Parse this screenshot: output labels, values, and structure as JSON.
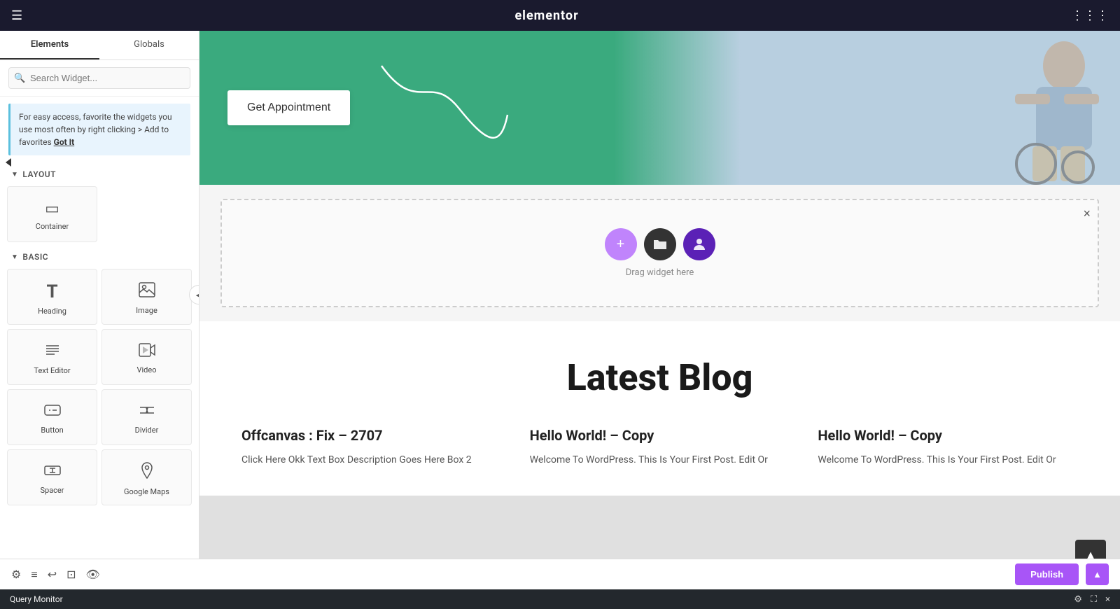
{
  "topbar": {
    "logo": "elementor",
    "hamburger_label": "☰",
    "grid_label": "⋮⋮⋮"
  },
  "sidebar": {
    "tabs": [
      {
        "id": "elements",
        "label": "Elements",
        "active": true
      },
      {
        "id": "globals",
        "label": "Globals",
        "active": false
      }
    ],
    "search_placeholder": "Search Widget...",
    "hint_text": "For easy access, favorite the widgets you use most often by right clicking > Add to favorites",
    "hint_cta": "Got It",
    "layout_section": {
      "label": "Layout",
      "widgets": [
        {
          "id": "container",
          "label": "Container",
          "icon": "▭"
        }
      ]
    },
    "basic_section": {
      "label": "Basic",
      "widgets": [
        {
          "id": "heading",
          "label": "Heading",
          "icon": "T"
        },
        {
          "id": "image",
          "label": "Image",
          "icon": "🖼"
        },
        {
          "id": "text-editor",
          "label": "Text Editor",
          "icon": "≡"
        },
        {
          "id": "video",
          "label": "Video",
          "icon": "▶"
        },
        {
          "id": "button",
          "label": "Button",
          "icon": "⊡"
        },
        {
          "id": "divider",
          "label": "Divider",
          "icon": "÷"
        },
        {
          "id": "spacer",
          "label": "Spacer",
          "icon": "⤢"
        },
        {
          "id": "google-maps",
          "label": "Google Maps",
          "icon": "📍"
        }
      ]
    }
  },
  "canvas": {
    "hero": {
      "button_text": "Get Appointment"
    },
    "dropzone": {
      "label": "Drag widget here",
      "close_label": "×"
    },
    "blog": {
      "title": "Latest Blog",
      "posts": [
        {
          "title": "Offcanvas : Fix – 2707",
          "excerpt": "Click Here Okk Text Box Description Goes Here Box 2"
        },
        {
          "title": "Hello World! – Copy",
          "excerpt": "Welcome To WordPress. This Is Your First Post. Edit Or"
        },
        {
          "title": "Hello World! – Copy",
          "excerpt": "Welcome To WordPress. This Is Your First Post. Edit Or"
        }
      ]
    }
  },
  "bottombar": {
    "icons": [
      "⚙",
      "≡",
      "↩",
      "⊡",
      "👁"
    ],
    "publish_label": "Publish",
    "query_monitor_label": "Query Monitor",
    "qm_icons": [
      "⚙",
      "⛶",
      "×"
    ]
  }
}
